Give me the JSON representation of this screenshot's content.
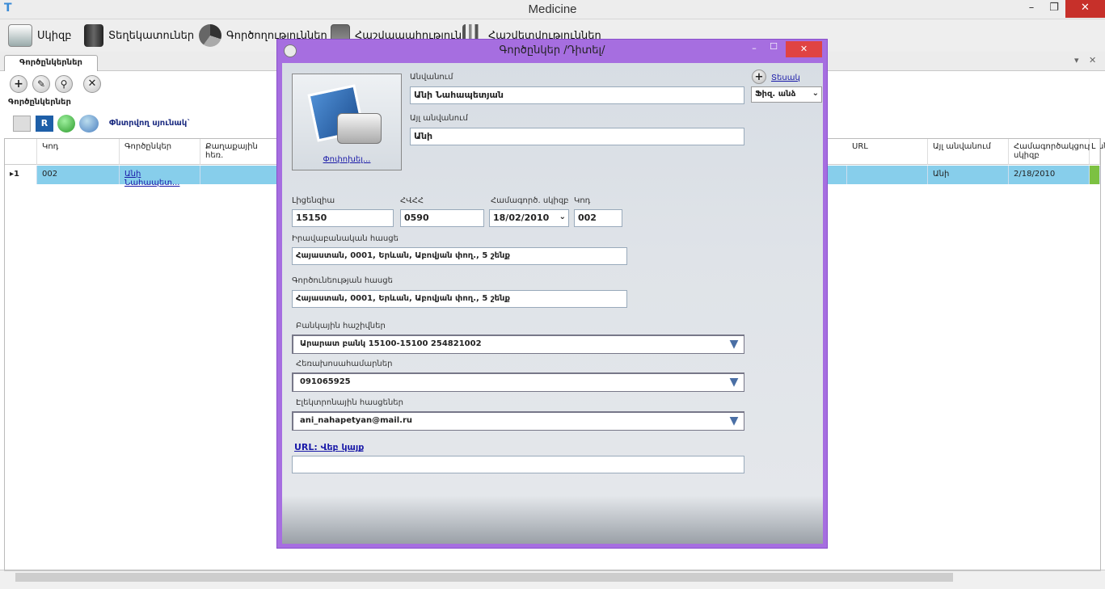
{
  "app": {
    "title": "Medicine",
    "close": "✕",
    "maximize": "❐",
    "minimize": "–",
    "logo": "T"
  },
  "menu": [
    {
      "label": "Սկիզբ",
      "icon": "start-icon"
    },
    {
      "label": "Տեղեկատուներ",
      "icon": "book-icon"
    },
    {
      "label": "Գործողություններ",
      "icon": "pie-chart-icon"
    },
    {
      "label": "Հաշվապահություն",
      "icon": "calculator-icon"
    },
    {
      "label": "Հաշվետվություններ",
      "icon": "bar-chart-icon"
    }
  ],
  "tabs": [
    {
      "label": "Գործընկերներ"
    }
  ],
  "tab_controls": {
    "dropdown": "▾",
    "close": "✕"
  },
  "toolbar": {
    "add": "+",
    "edit": "✎",
    "search": "⚲",
    "delete": "✕"
  },
  "list": {
    "label": "Գործընկերներ",
    "selected_filter": "Փնտրվող սյունակ`"
  },
  "grid": {
    "headers": [
      "Կոդ",
      "Գործընկեր",
      "Քաղաքային հեռ.",
      "URL",
      "Այլ անվանում",
      "Համագործակցության սկիզբ",
      "Լ"
    ],
    "row": {
      "marker": "▸1",
      "code": "002",
      "partner": "Անի Նահապետ...",
      "url": "",
      "alt_name": "Անի",
      "start": "2/18/2010"
    }
  },
  "dialog": {
    "title": "Գործընկեր /Դիտել/",
    "photo_link": "Փոփոխել...",
    "name_label": "Անվանում",
    "name_value": "Անի Նահապետյան",
    "alt_label": "Այլ անվանում",
    "alt_value": "Անի",
    "type_link": "Տեսակ",
    "type_value": "Ֆիզ. անձ",
    "license_label": "Լիցենզիա",
    "license_value": "15150",
    "hvhh_label": "ՀՎՀՀ",
    "hvhh_value": "0590",
    "coop_label": "Համագործ. սկիզբ",
    "coop_value": "18/02/2010",
    "code_label": "Կոդ",
    "code_value": "002",
    "legal_label": "Իրավաբանական հասցե",
    "legal_value": "Հայաստան, 0001, Երևան, Աբովյան փող., 5 շենք",
    "work_label": "Գործունեության հասցե",
    "work_value": "Հայաստան, 0001, Երևան, Աբովյան փող., 5 շենք",
    "bank_label": "Բանկային հաշիվներ",
    "bank_value": "Արարատ բանկ 15100-15100 254821002",
    "phone_label": "Հեռախոսահամարներ",
    "phone_value": "091065925",
    "email_label": "Էլեկտրոնային հասցեներ",
    "email_value": "ani_nahapetyan@mail.ru",
    "url_link": "URL: Վեբ կայք",
    "url_value": "",
    "controls": {
      "close": "✕",
      "maximize": "☐",
      "minimize": "–"
    }
  },
  "colors": {
    "dialog_frame": "#a66ee0",
    "selection": "#87ceeb",
    "close_button": "#e04343"
  }
}
